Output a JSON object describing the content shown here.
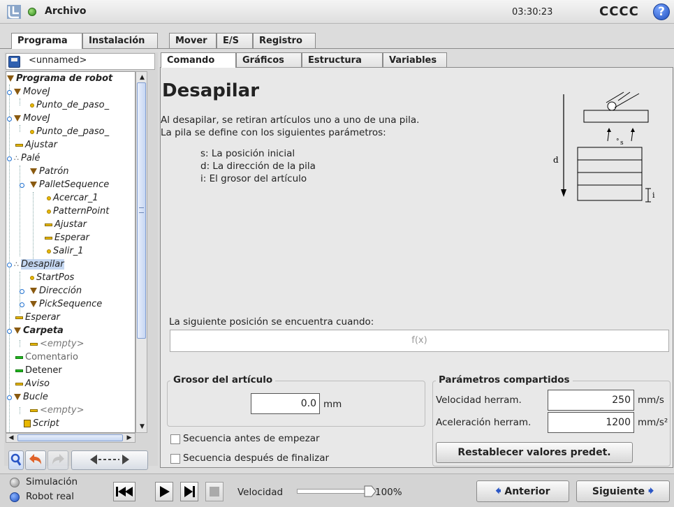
{
  "titlebar": {
    "app_title": "Archivo",
    "clock": "03:30:23",
    "robot_name": "CCCC",
    "help": "?"
  },
  "main_tabs": [
    "Programa",
    "Instalación",
    "Mover",
    "E/S",
    "Registro"
  ],
  "file": {
    "name": "<unnamed>"
  },
  "tree": [
    "Programa de robot",
    "MoveJ",
    "Punto_de_paso_",
    "MoveJ",
    "Punto_de_paso_",
    "Ajustar",
    "Palé",
    "Patrón",
    "PalletSequence",
    "Acercar_1",
    "PatternPoint",
    "Ajustar",
    "Esperar",
    "Salir_1",
    "Desapilar",
    "StartPos",
    "Dirección",
    "PickSequence",
    "Esperar",
    "Carpeta",
    "<empty>",
    "Comentario",
    "Detener",
    "Aviso",
    "Bucle",
    "<empty>",
    "Script"
  ],
  "sub_tabs": [
    "Comando",
    "Gráficos",
    "Estructura",
    "Variables"
  ],
  "command": {
    "heading": "Desapilar",
    "desc_line1": "Al desapilar, se retiran artículos uno a uno de una pila.",
    "desc_line2": "La pila se define con los siguientes parámetros:",
    "param_s": "s: La posición inicial",
    "param_d": "d: La dirección de la pila",
    "param_i": "i: El grosor del artículo",
    "diagram_labels": {
      "d": "d",
      "s": "s",
      "i": "i"
    },
    "next_pos_label": "La siguiente posición se encuentra cuando:",
    "fx_placeholder": "f(x)"
  },
  "thickness": {
    "title": "Grosor del artículo",
    "value": "0.0",
    "unit": "mm"
  },
  "shared": {
    "title": "Parámetros compartidos",
    "speed_label": "Velocidad herram.",
    "speed_value": "250",
    "speed_unit": "mm/s",
    "accel_label": "Aceleración herram.",
    "accel_value": "1200",
    "accel_unit": "mm/s²",
    "reset_label": "Restablecer valores predet."
  },
  "options": {
    "before_label": "Secuencia antes de empezar",
    "before_checked": false,
    "after_label": "Secuencia después de finalizar",
    "after_checked": false
  },
  "footer": {
    "mode_sim": "Simulación",
    "mode_real": "Robot real",
    "speed_label": "Velocidad",
    "speed_value": "100%",
    "speed_fraction": 1.0,
    "prev_label": "Anterior",
    "next_label": "Siguiente"
  },
  "colors": {
    "accent_green": "#22b820",
    "accent_yellow": "#e8b800",
    "selection": "#c5d8f2",
    "arrow_blue": "#2a56c6"
  }
}
